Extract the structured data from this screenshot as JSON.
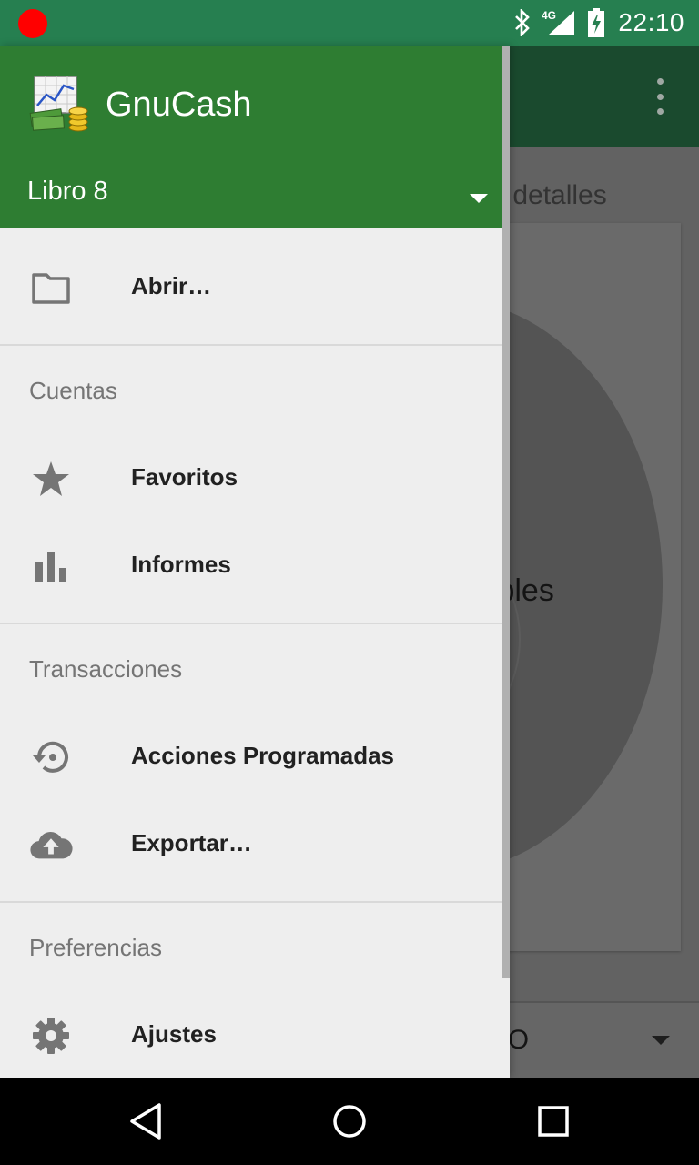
{
  "status_bar": {
    "time": "22:10",
    "network_label": "4G",
    "icons": [
      "recording-dot-icon",
      "bluetooth-icon",
      "signal-icon",
      "battery-charging-icon"
    ],
    "recording_color": "#ff0000"
  },
  "background_app": {
    "tab_partial_text": "s detalles",
    "chart_partial_text": "nibles",
    "spinner_partial_text": "STO",
    "toolbar_icon": "overflow-menu-icon"
  },
  "drawer": {
    "header": {
      "app_name": "GnuCash",
      "book_name": "Libro 8",
      "logo_icon": "gnucash-logo-icon",
      "dropdown_icon": "dropdown-arrow-icon",
      "background_color": "#2e7d32"
    },
    "open": {
      "label": "Abrir…",
      "icon": "folder-icon"
    },
    "sections": [
      {
        "title": "Cuentas",
        "items": [
          {
            "label": "Favoritos",
            "icon": "star-icon"
          },
          {
            "label": "Informes",
            "icon": "bar-chart-icon"
          }
        ]
      },
      {
        "title": "Transacciones",
        "items": [
          {
            "label": "Acciones Programadas",
            "icon": "history-icon"
          },
          {
            "label": "Exportar…",
            "icon": "cloud-upload-icon"
          }
        ]
      },
      {
        "title": "Preferencias",
        "items": [
          {
            "label": "Ajustes",
            "icon": "gear-icon"
          }
        ]
      }
    ]
  },
  "nav_bar": {
    "buttons": [
      "back-icon",
      "home-icon",
      "recents-icon"
    ]
  }
}
